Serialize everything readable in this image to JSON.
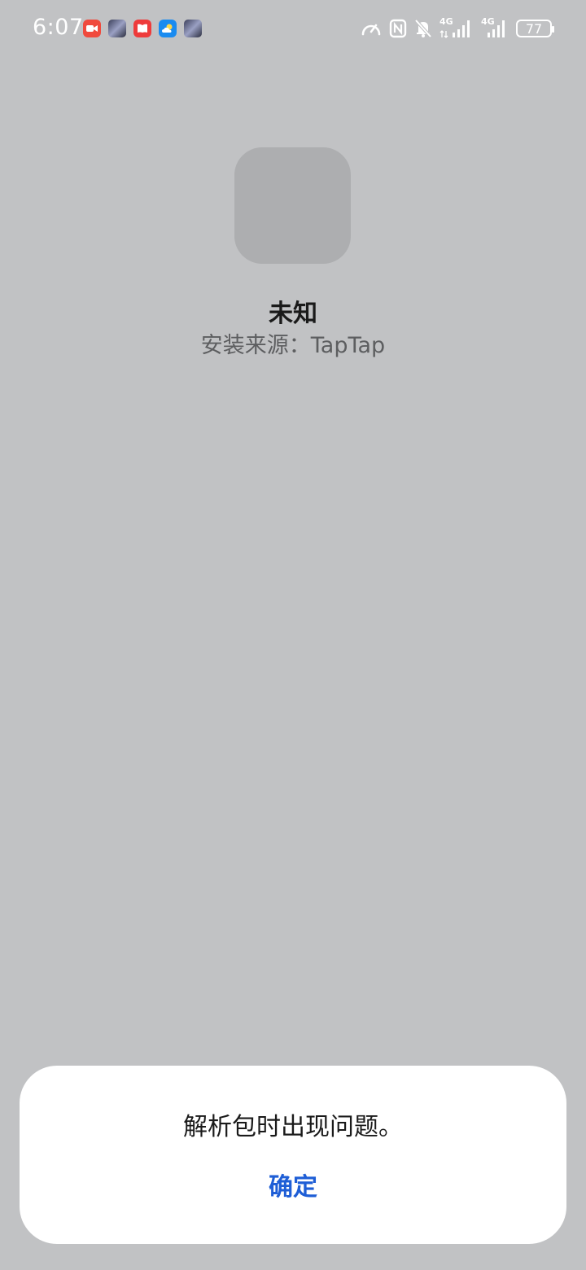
{
  "status_bar": {
    "time": "6:07",
    "battery_level": "77",
    "network_label_1": "4G",
    "network_label_2": "4G",
    "notification_icons": [
      "video-app-icon",
      "game-avatar-icon",
      "book-app-icon",
      "weather-app-icon",
      "game-avatar-icon"
    ],
    "system_icons": [
      "speed-gauge-icon",
      "nfc-icon",
      "bell-muted-icon",
      "signal-4g-icon",
      "signal-4g-icon",
      "battery-icon"
    ]
  },
  "app_info": {
    "name": "未知",
    "install_source": "安装来源：TapTap"
  },
  "dialog": {
    "message": "解析包时出现问题。",
    "confirm_label": "确定"
  },
  "colors": {
    "background": "#c1c2c4",
    "app_icon_placeholder": "#adaeb0",
    "dialog_background": "#ffffff",
    "accent": "#1e5ed6"
  }
}
